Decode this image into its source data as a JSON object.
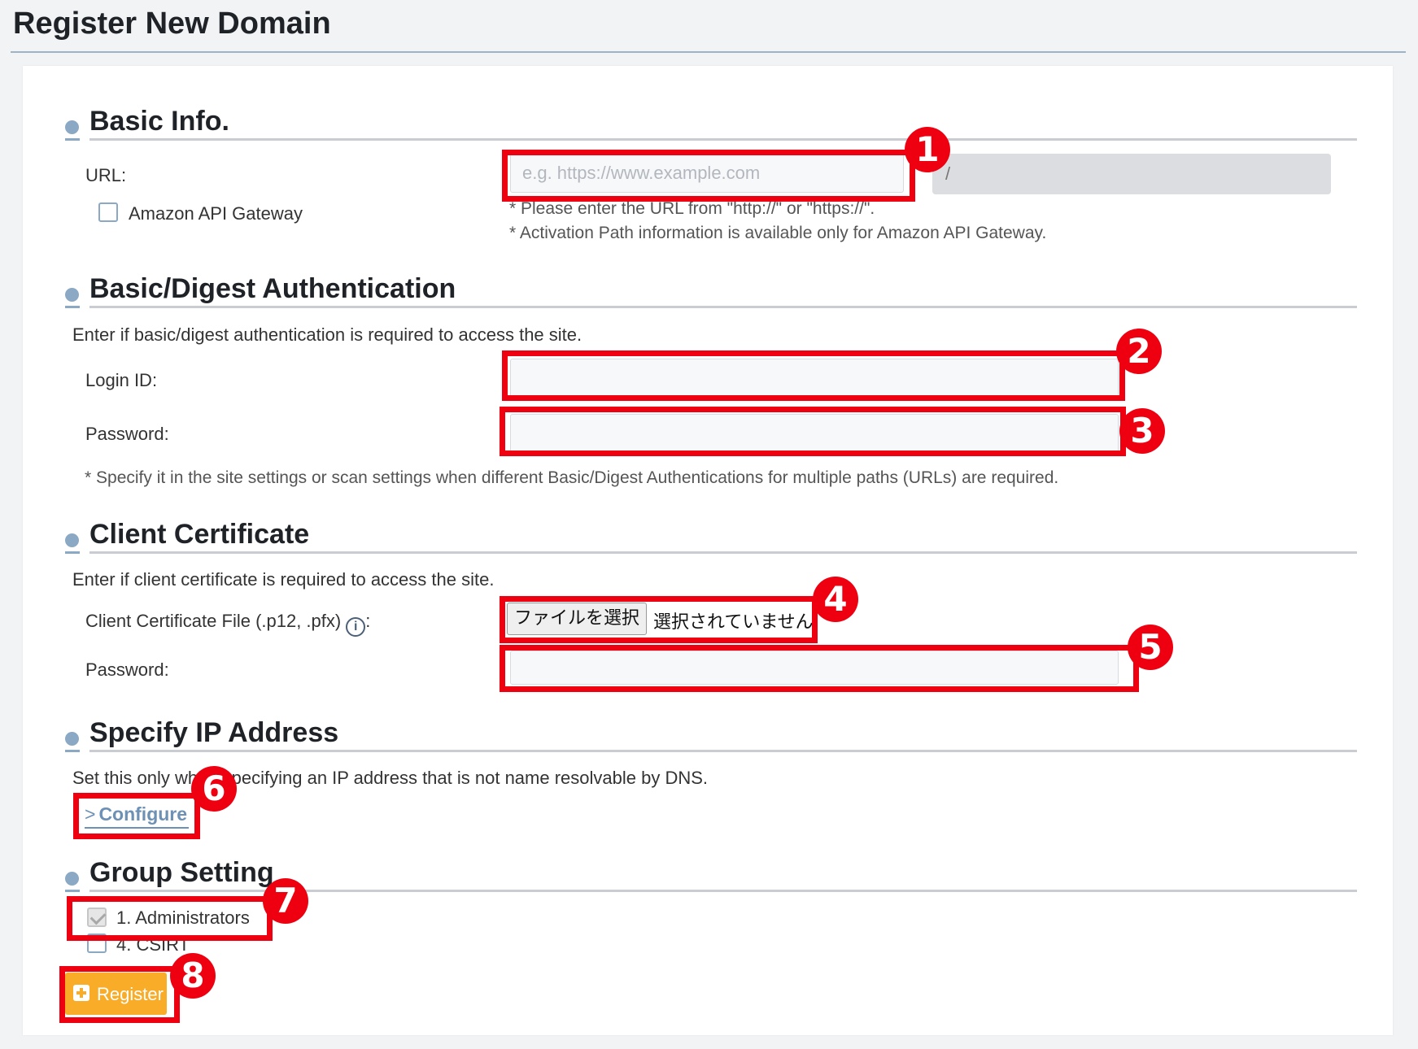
{
  "page_title": "Register New Domain",
  "basic_info": {
    "heading": "Basic Info.",
    "url_label": "URL:",
    "url_placeholder": "e.g. https://www.example.com",
    "path_prefix": "/",
    "api_gateway_label": "Amazon API Gateway",
    "api_gateway_checked": false,
    "note1": "* Please enter the URL from \"http://\" or \"https://\".",
    "note2": "* Activation Path information is available only for Amazon API Gateway."
  },
  "auth": {
    "heading": "Basic/Digest Authentication",
    "description": "Enter if basic/digest authentication is required to access the site.",
    "login_label": "Login ID:",
    "login_value": "",
    "password_label": "Password:",
    "password_value": "",
    "note": "* Specify it in the site settings or scan settings when different Basic/Digest Authentications for multiple paths (URLs) are required."
  },
  "client_cert": {
    "heading": "Client Certificate",
    "description": "Enter if client certificate is required to access the site.",
    "file_label": "Client Certificate File (.p12, .pfx)",
    "file_label_suffix": ":",
    "file_button": "ファイルを選択",
    "file_status": "選択されていません",
    "password_label": "Password:",
    "password_value": ""
  },
  "ip": {
    "heading": "Specify IP Address",
    "description": "Set this only when specifying an IP address that is not name resolvable by DNS.",
    "configure_label": "Configure",
    "configure_chevron": ">"
  },
  "groups": {
    "heading": "Group Setting",
    "items": [
      {
        "label": "1. Administrators",
        "checked": true,
        "disabled": true
      },
      {
        "label": "4. CSIRT",
        "checked": false,
        "disabled": false
      }
    ]
  },
  "register_label": "Register",
  "callouts": [
    "1",
    "2",
    "3",
    "4",
    "5",
    "6",
    "7",
    "8"
  ],
  "colors": {
    "accent": "#8ba8c4",
    "link": "#6d90b5",
    "register": "#f8ac27",
    "callout": "#ee0010"
  }
}
